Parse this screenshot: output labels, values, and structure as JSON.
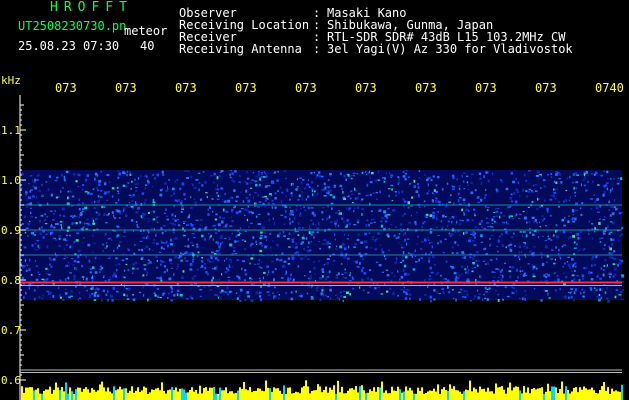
{
  "header": {
    "title": "HROFFT",
    "filename": "UT2508230730.pn",
    "event_type": "meteor",
    "datetime": "25.08.23 07:30",
    "count": "40"
  },
  "info": [
    {
      "key": "Observer",
      "value": "Masaki Kano"
    },
    {
      "key": "Receiving Location",
      "value": "Shibukawa, Gunma, Japan"
    },
    {
      "key": "Receiver",
      "value": "RTL-SDR SDR# 43dB L15 103.2MHz CW"
    },
    {
      "key": "Receiving Antenna",
      "value": "3el Yagi(V) Az 330 for Vladivostok"
    }
  ],
  "spectrogram": {
    "y_axis_unit": "kHz",
    "y_ticks": [
      "1.1",
      "1.0",
      "0.9",
      "0.8",
      "0.7",
      "0.6"
    ],
    "y_tick_values": [
      1.1,
      1.0,
      0.9,
      0.8,
      0.7,
      0.6
    ],
    "time_labels": [
      "073",
      "073",
      "073",
      "073",
      "073",
      "073",
      "073",
      "073",
      "073",
      "0740"
    ],
    "band_khz": [
      0.76,
      1.02
    ],
    "carrier_khz": 0.795,
    "colors": {
      "axis": "#ffffff",
      "labels": "#ffff33",
      "baseline_noise": "#ffff00"
    }
  }
}
